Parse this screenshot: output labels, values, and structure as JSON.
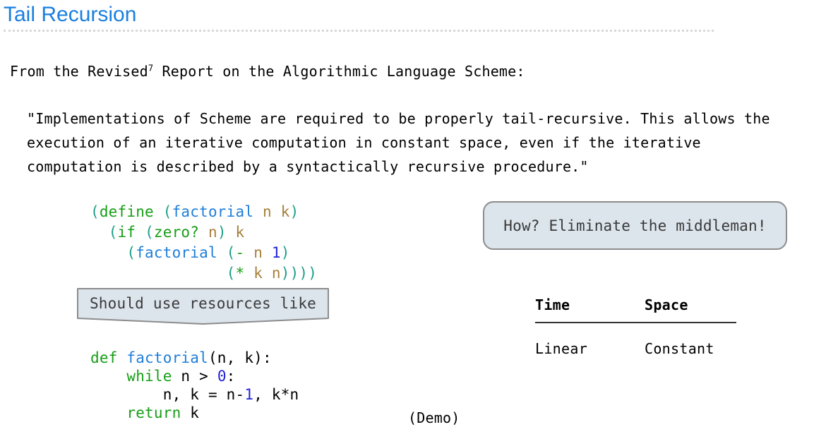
{
  "slide": {
    "title": "Tail Recursion",
    "title_color": "#1a7fe0",
    "rule_color": "#d8d8d8"
  },
  "intro": {
    "text_before": "From the Revised",
    "superscript": "7",
    "text_after": " Report on the Algorithmic Language Scheme:"
  },
  "quote": {
    "lines": [
      "\"Implementations of Scheme are required to be properly tail-recursive. This allows the",
      "execution of an iterative computation in constant space, even if the iterative",
      "computation is described by a syntactically recursive procedure.\""
    ]
  },
  "scheme_code": {
    "language": "scheme",
    "lines": [
      "(define (factorial n k)",
      "  (if (zero? n) k",
      "    (factorial (- n 1)",
      "               (* k n))))"
    ],
    "tokens": [
      [
        {
          "t": "(",
          "c": "paren"
        },
        {
          "t": "define",
          "c": "kw"
        },
        {
          "t": " ",
          "c": "plain"
        },
        {
          "t": "(",
          "c": "paren"
        },
        {
          "t": "factorial",
          "c": "fn"
        },
        {
          "t": " ",
          "c": "plain"
        },
        {
          "t": "n",
          "c": "var"
        },
        {
          "t": " ",
          "c": "plain"
        },
        {
          "t": "k",
          "c": "var"
        },
        {
          "t": ")",
          "c": "paren"
        }
      ],
      [
        {
          "t": "  ",
          "c": "plain"
        },
        {
          "t": "(",
          "c": "paren"
        },
        {
          "t": "if",
          "c": "kw"
        },
        {
          "t": " ",
          "c": "plain"
        },
        {
          "t": "(",
          "c": "paren"
        },
        {
          "t": "zero?",
          "c": "kw"
        },
        {
          "t": " ",
          "c": "plain"
        },
        {
          "t": "n",
          "c": "var"
        },
        {
          "t": ")",
          "c": "paren"
        },
        {
          "t": " ",
          "c": "plain"
        },
        {
          "t": "k",
          "c": "var"
        }
      ],
      [
        {
          "t": "    ",
          "c": "plain"
        },
        {
          "t": "(",
          "c": "paren"
        },
        {
          "t": "factorial",
          "c": "fn"
        },
        {
          "t": " ",
          "c": "plain"
        },
        {
          "t": "(",
          "c": "paren"
        },
        {
          "t": "-",
          "c": "op"
        },
        {
          "t": " ",
          "c": "plain"
        },
        {
          "t": "n",
          "c": "var"
        },
        {
          "t": " ",
          "c": "plain"
        },
        {
          "t": "1",
          "c": "num"
        },
        {
          "t": ")",
          "c": "paren"
        }
      ],
      [
        {
          "t": "               ",
          "c": "plain"
        },
        {
          "t": "(",
          "c": "paren"
        },
        {
          "t": "*",
          "c": "op"
        },
        {
          "t": " ",
          "c": "plain"
        },
        {
          "t": "k",
          "c": "var"
        },
        {
          "t": " ",
          "c": "plain"
        },
        {
          "t": "n",
          "c": "var"
        },
        {
          "t": ")",
          "c": "paren"
        },
        {
          "t": ")",
          "c": "paren"
        },
        {
          "t": ")",
          "c": "paren"
        },
        {
          "t": ")",
          "c": "paren"
        }
      ]
    ]
  },
  "python_code": {
    "language": "python",
    "lines": [
      "def factorial(n, k):",
      "    while n > 0:",
      "        n, k = n-1, k*n",
      "    return k"
    ],
    "tokens": [
      [
        {
          "t": "def",
          "c": "kw"
        },
        {
          "t": " ",
          "c": "plain"
        },
        {
          "t": "factorial",
          "c": "fn"
        },
        {
          "t": "(n, k):",
          "c": "plain"
        }
      ],
      [
        {
          "t": "    ",
          "c": "plain"
        },
        {
          "t": "while",
          "c": "kw"
        },
        {
          "t": " n > ",
          "c": "plain"
        },
        {
          "t": "0",
          "c": "num"
        },
        {
          "t": ":",
          "c": "plain"
        }
      ],
      [
        {
          "t": "        n, k = n-",
          "c": "plain"
        },
        {
          "t": "1",
          "c": "num"
        },
        {
          "t": ", k*n",
          "c": "plain"
        }
      ],
      [
        {
          "t": "    ",
          "c": "plain"
        },
        {
          "t": "return",
          "c": "kw"
        },
        {
          "t": " k",
          "c": "plain"
        }
      ]
    ]
  },
  "callout_rounded": {
    "text": "How? Eliminate the middleman!",
    "fill": "#dce4ec",
    "border": "#8c8c8c"
  },
  "callout_banner": {
    "text": "Should use resources like",
    "fill": "#dce4ec",
    "border": "#8c8c8c"
  },
  "complexity_table": {
    "headers": [
      "Time",
      "Space"
    ],
    "rows": [
      [
        "Linear",
        "Constant"
      ]
    ]
  },
  "demo_note": {
    "text": "(Demo)"
  }
}
